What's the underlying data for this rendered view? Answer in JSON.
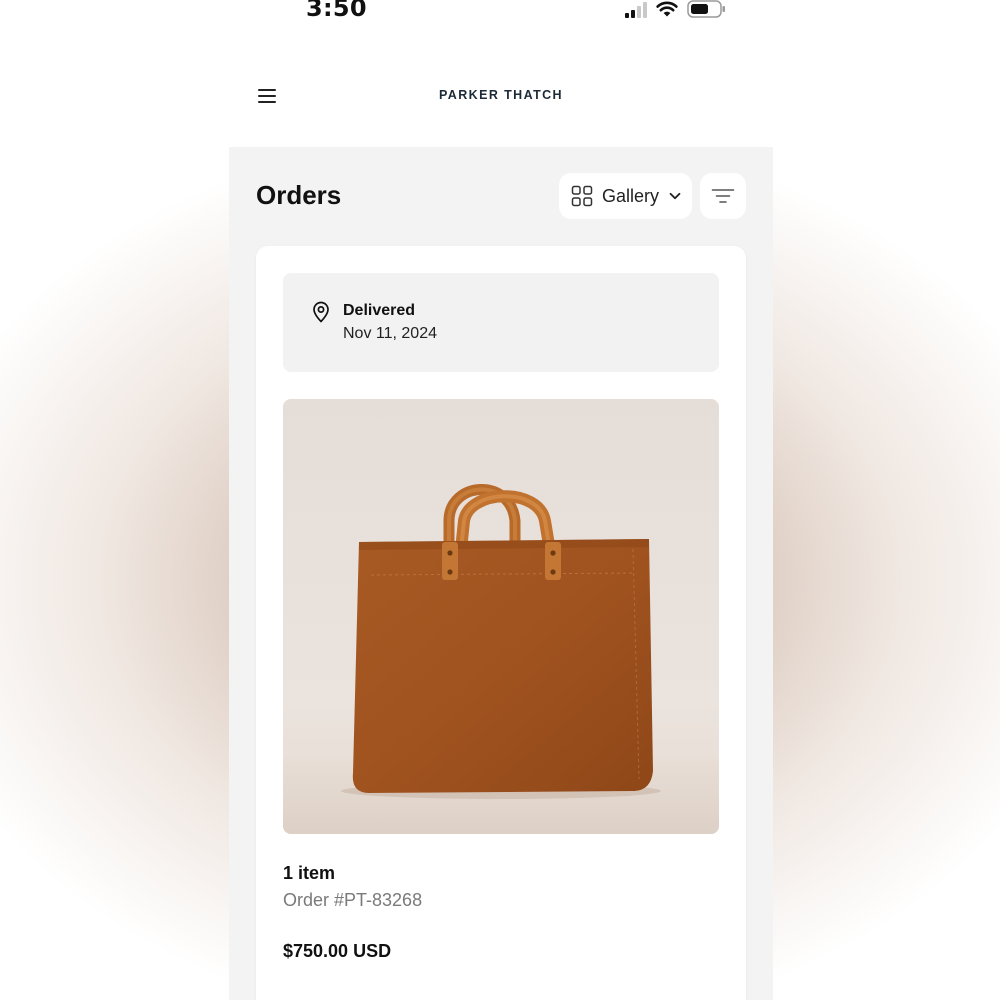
{
  "status_bar": {
    "time": "3:50",
    "signal_icon": "cellular-signal-icon",
    "wifi_icon": "wifi-icon",
    "battery_icon": "battery-icon"
  },
  "header": {
    "menu_icon": "hamburger-menu-icon",
    "brand": "PARKER THATCH"
  },
  "page": {
    "title": "Orders",
    "view_selector": {
      "icon": "grid-icon",
      "label": "Gallery",
      "chevron_icon": "chevron-down-icon"
    },
    "filter_icon": "filter-icon"
  },
  "order": {
    "status_icon": "location-pin-icon",
    "status": "Delivered",
    "date": "Nov 11, 2024",
    "product_image": "brown-suede-tote-bag",
    "item_count": "1 item",
    "order_number": "Order #PT-83268",
    "total": "$750.00 USD"
  },
  "colors": {
    "brand": "#1c2a38",
    "background": "#f4f3f3",
    "bag": "#a0531f"
  }
}
